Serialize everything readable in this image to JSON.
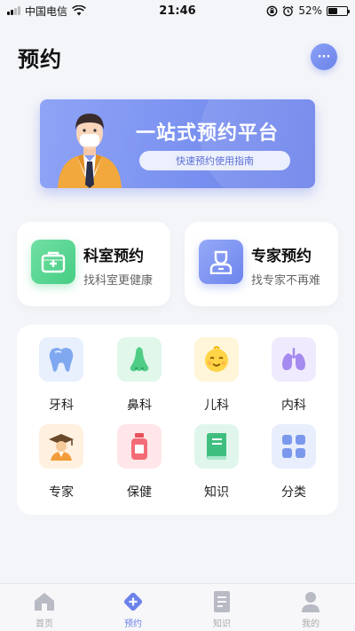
{
  "status_bar": {
    "carrier": "中国电信",
    "time": "21:46",
    "battery_percent": "52%",
    "battery_level": 0.52
  },
  "header": {
    "title": "预约",
    "more_label": "···"
  },
  "banner": {
    "title": "一站式预约平台",
    "guide_label": "快速预约使用指南"
  },
  "features": [
    {
      "title": "科室预约",
      "subtitle": "找科室更健康",
      "icon": "medical-kit-icon"
    },
    {
      "title": "专家预约",
      "subtitle": "找专家不再难",
      "icon": "doctor-icon"
    }
  ],
  "categories": [
    {
      "label": "牙科",
      "icon": "tooth-icon"
    },
    {
      "label": "鼻科",
      "icon": "nose-icon"
    },
    {
      "label": "儿科",
      "icon": "baby-face-icon"
    },
    {
      "label": "内科",
      "icon": "lungs-icon"
    },
    {
      "label": "专家",
      "icon": "graduate-icon"
    },
    {
      "label": "保健",
      "icon": "medicine-bottle-icon"
    },
    {
      "label": "知识",
      "icon": "book-icon"
    },
    {
      "label": "分类",
      "icon": "grid-icon"
    }
  ],
  "tabs": [
    {
      "label": "首页",
      "icon": "home-icon",
      "active": false
    },
    {
      "label": "预约",
      "icon": "appointment-icon",
      "active": true
    },
    {
      "label": "知识",
      "icon": "document-icon",
      "active": false
    },
    {
      "label": "我的",
      "icon": "user-icon",
      "active": false
    }
  ],
  "colors": {
    "accent": "#6b82ea",
    "green": "#45cd84",
    "background": "#f4f5f9"
  }
}
